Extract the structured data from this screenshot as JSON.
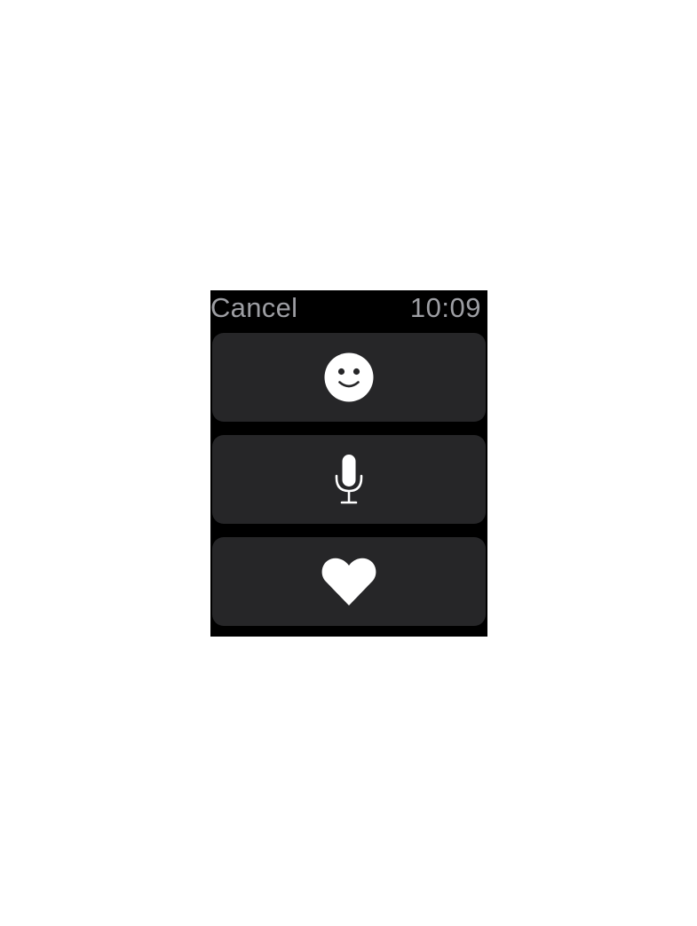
{
  "status_bar": {
    "cancel_label": "Cancel",
    "time": "10:09"
  },
  "actions": [
    {
      "id": "emoji",
      "icon": "smiley-face-icon"
    },
    {
      "id": "dictation",
      "icon": "microphone-icon"
    },
    {
      "id": "digital-touch",
      "icon": "heart-icon"
    }
  ],
  "colors": {
    "screen_background": "#000000",
    "button_background": "#262628",
    "icon_color": "#ffffff",
    "status_text": "#9d9ea3"
  }
}
